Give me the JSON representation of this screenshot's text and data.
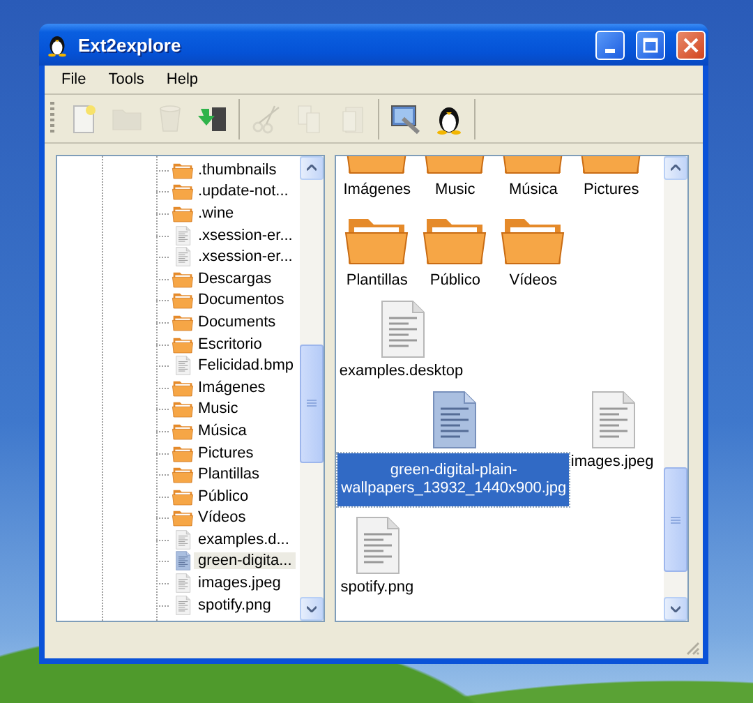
{
  "window": {
    "title": "Ext2explore"
  },
  "menu": [
    "File",
    "Tools",
    "Help"
  ],
  "toolbar": [
    [
      {
        "kind": "new",
        "disabled": false
      },
      {
        "kind": "folder",
        "disabled": true
      },
      {
        "kind": "trash",
        "disabled": true
      },
      {
        "kind": "export",
        "disabled": false
      }
    ],
    [
      {
        "kind": "cut",
        "disabled": true
      },
      {
        "kind": "copy",
        "disabled": true
      },
      {
        "kind": "paste",
        "disabled": true
      }
    ],
    [
      {
        "kind": "settings",
        "disabled": false
      },
      {
        "kind": "penguin",
        "disabled": false
      }
    ]
  ],
  "tree": {
    "items": [
      {
        "label": ".thumbnails",
        "kind": "folder",
        "selected": false
      },
      {
        "label": ".update-not...",
        "kind": "folder",
        "selected": false
      },
      {
        "label": ".wine",
        "kind": "folder",
        "selected": false
      },
      {
        "label": ".xsession-er...",
        "kind": "file",
        "selected": false
      },
      {
        "label": ".xsession-er...",
        "kind": "file",
        "selected": false
      },
      {
        "label": "Descargas",
        "kind": "folder",
        "selected": false
      },
      {
        "label": "Documentos",
        "kind": "folder",
        "selected": false
      },
      {
        "label": "Documents",
        "kind": "folder",
        "selected": false
      },
      {
        "label": "Escritorio",
        "kind": "folder",
        "selected": false
      },
      {
        "label": "Felicidad.bmp",
        "kind": "file",
        "selected": false
      },
      {
        "label": "Imágenes",
        "kind": "folder",
        "selected": false
      },
      {
        "label": "Music",
        "kind": "folder",
        "selected": false
      },
      {
        "label": "Música",
        "kind": "folder",
        "selected": false
      },
      {
        "label": "Pictures",
        "kind": "folder",
        "selected": false
      },
      {
        "label": "Plantillas",
        "kind": "folder",
        "selected": false
      },
      {
        "label": "Público",
        "kind": "folder",
        "selected": false
      },
      {
        "label": "Vídeos",
        "kind": "folder",
        "selected": false
      },
      {
        "label": "examples.d...",
        "kind": "file",
        "selected": false
      },
      {
        "label": "green-digita...",
        "kind": "file",
        "selected": true
      },
      {
        "label": "images.jpeg",
        "kind": "file",
        "selected": false
      },
      {
        "label": "spotify.png",
        "kind": "file",
        "selected": false
      }
    ]
  },
  "files": [
    {
      "label": "Imágenes",
      "kind": "folder",
      "selected": false
    },
    {
      "label": "Music",
      "kind": "folder",
      "selected": false
    },
    {
      "label": "Música",
      "kind": "folder",
      "selected": false
    },
    {
      "label": "Pictures",
      "kind": "folder",
      "selected": false
    },
    {
      "label": "Plantillas",
      "kind": "folder",
      "selected": false
    },
    {
      "label": "Público",
      "kind": "folder",
      "selected": false
    },
    {
      "label": "Vídeos",
      "kind": "folder",
      "selected": false
    },
    {
      "label": "examples.desktop",
      "kind": "file",
      "selected": false
    },
    {
      "label": "green-digital-plain-wallpapers_13932_1440x900.jpg",
      "kind": "file",
      "selected": true
    },
    {
      "label": "images.jpeg",
      "kind": "file",
      "selected": false
    },
    {
      "label": "spotify.png",
      "kind": "file",
      "selected": false
    }
  ]
}
